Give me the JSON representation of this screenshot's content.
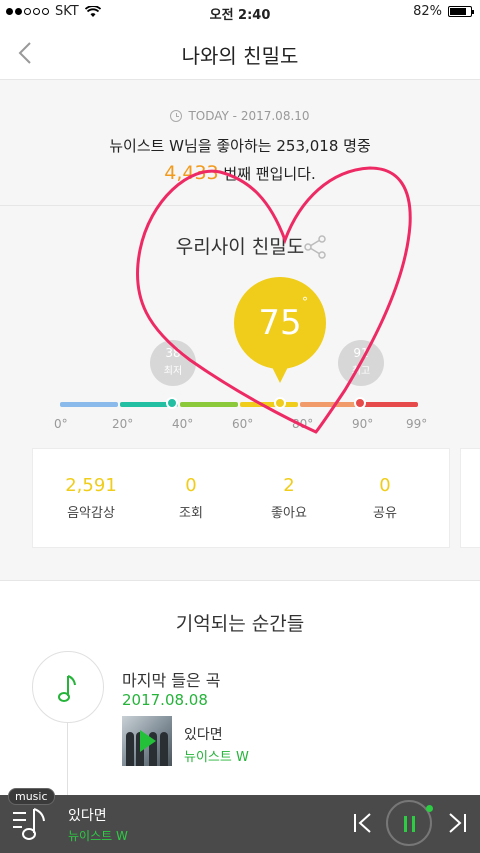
{
  "status_bar": {
    "carrier": "SKT",
    "time": "오전 2:40",
    "battery": "82%",
    "battery_fraction": 0.82
  },
  "header": {
    "title": "나와의 친밀도"
  },
  "fan_info": {
    "today": "TODAY - 2017.08.10",
    "line1": "뉴이스트 W님을 좋아하는 253,018 명중",
    "rank": "4,433",
    "rank_suffix": " 번째 팬입니다."
  },
  "intimacy": {
    "title": "우리사이 친밀도",
    "score": "75",
    "degree": "°",
    "low_marker": {
      "value": "38",
      "label": "최저"
    },
    "high_marker": {
      "value": "91",
      "label": "최고"
    },
    "ticks": [
      "0°",
      "20°",
      "40°",
      "60°",
      "80°",
      "90°",
      "99°"
    ],
    "scale_colors": [
      "#8ab9ec",
      "#22bfa2",
      "#8cc93a",
      "#f0cd1a",
      "#f29b6a",
      "#e64a4a"
    ],
    "colors": {
      "accent": "#f0cd1a",
      "rank": "#f19a1c",
      "green": "#26b33a",
      "annotation": "#ee2a64"
    }
  },
  "stats": [
    {
      "value": "2,591",
      "label": "음악감상"
    },
    {
      "value": "0",
      "label": "조회"
    },
    {
      "value": "2",
      "label": "좋아요"
    },
    {
      "value": "0",
      "label": "공유"
    }
  ],
  "memories": {
    "title": "기억되는 순간들",
    "item": {
      "heading": "마지막 들은 곡",
      "date": "2017.08.08",
      "song_title": "있다면",
      "artist": "뉴이스트 W"
    }
  },
  "player": {
    "badge": "music",
    "title": "있다면",
    "artist": "뉴이스트 W"
  }
}
